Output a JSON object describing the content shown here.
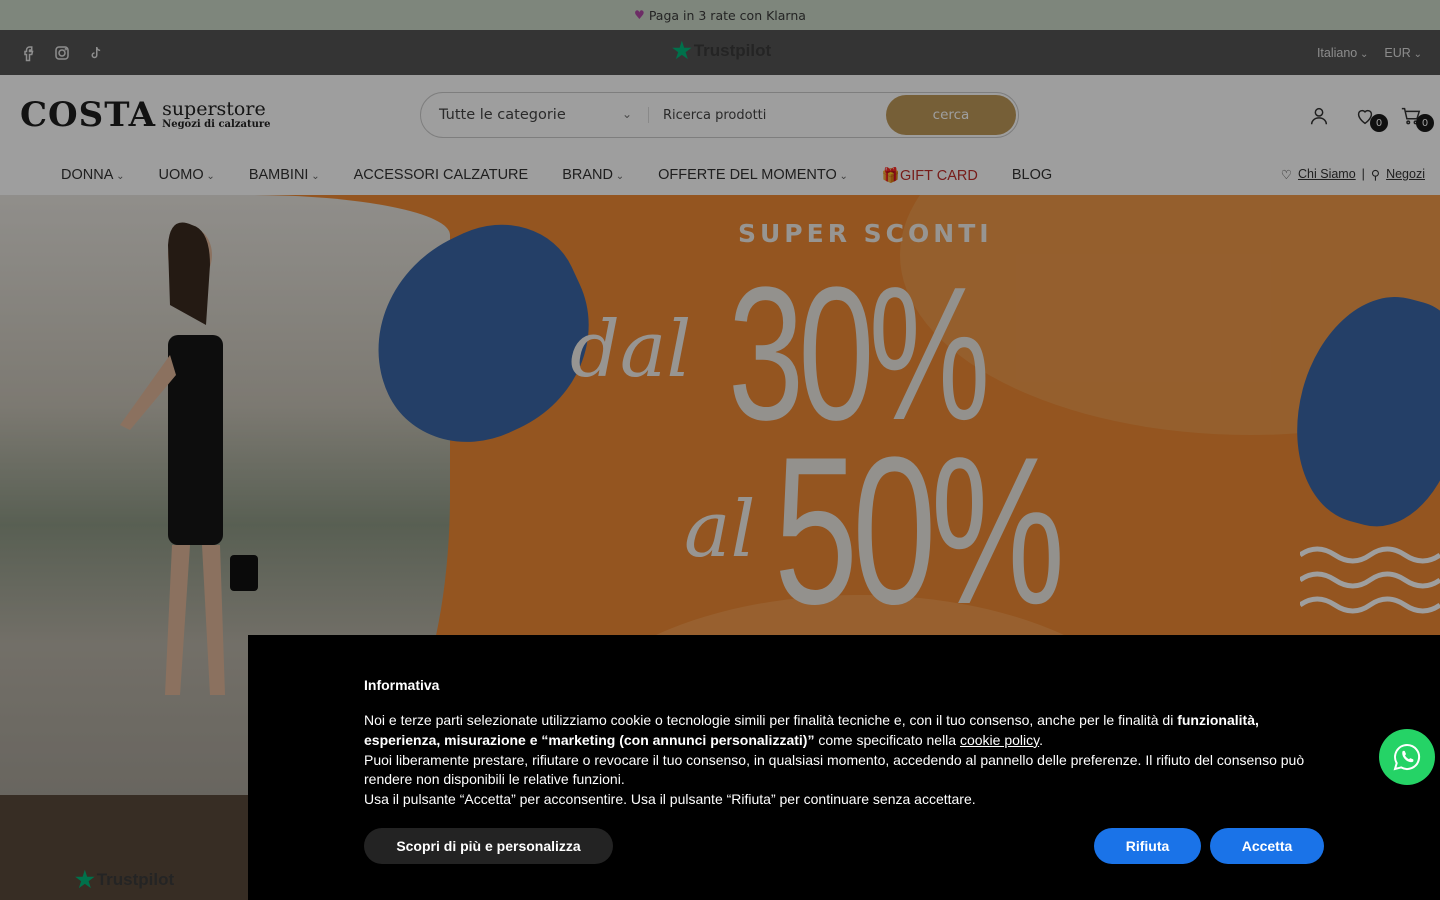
{
  "announcement": {
    "text": "Paga in 3 rate con Klarna",
    "icon": "heart-icon"
  },
  "topbar": {
    "social": [
      "facebook-icon",
      "instagram-icon",
      "tiktok-icon"
    ],
    "trustpilot": "Trustpilot",
    "language": "Italiano",
    "currency": "EUR"
  },
  "header": {
    "logo_main": "COSTA",
    "logo_sub1": "superstore",
    "logo_sub2": "Negozi di calzature",
    "search": {
      "category": "Tutte le categorie",
      "placeholder": "Ricerca prodotti",
      "button": "cerca"
    },
    "wishlist_count": "0",
    "cart_count": "0"
  },
  "nav": {
    "items": [
      {
        "label": "DONNA",
        "dropdown": true
      },
      {
        "label": "UOMO",
        "dropdown": true
      },
      {
        "label": "BAMBINI",
        "dropdown": true
      },
      {
        "label": "ACCESSORI CALZATURE",
        "dropdown": false
      },
      {
        "label": "BRAND",
        "dropdown": true
      },
      {
        "label": "OFFERTE DEL MOMENTO",
        "dropdown": true
      },
      {
        "label": "GIFT CARD",
        "dropdown": false
      },
      {
        "label": "BLOG",
        "dropdown": false
      }
    ],
    "chi_siamo": "Chi Siamo",
    "separator": "|",
    "negozi": "Negozi"
  },
  "hero": {
    "super": "SUPER SCONTI",
    "dal": "dal",
    "p30": "30%",
    "al": "al",
    "p50": "50%"
  },
  "bottom_trustpilot": "Trustpilot",
  "cookie": {
    "title": "Informativa",
    "p1_start": "Noi e terze parti selezionate utilizziamo cookie o tecnologie simili per finalità tecniche e, con il tuo consenso, anche per le finalità di ",
    "p1_bold": "funzionalità, esperienza, misurazione e “marketing (con annunci personalizzati)”",
    "p1_mid": " come specificato nella ",
    "p1_link": "cookie policy",
    "p1_end": ".",
    "p2": "Puoi liberamente prestare, rifiutare o revocare il tuo consenso, in qualsiasi momento, accedendo al pannello delle preferenze. Il rifiuto del consenso può rendere non disponibili le relative funzioni.",
    "p3": "Usa il pulsante “Accetta” per acconsentire. Usa il pulsante “Rifiuta” per continuare senza accettare.",
    "btn_more": "Scopri di più e personalizza",
    "btn_reject": "Rifiuta",
    "btn_accept": "Accetta"
  },
  "colors": {
    "accent_gold": "#bf9a5a",
    "hero_orange": "#ef8a34",
    "leaf_blue": "#3a67a6",
    "cookie_blue": "#1a73e8",
    "whatsapp_green": "#25d366"
  }
}
